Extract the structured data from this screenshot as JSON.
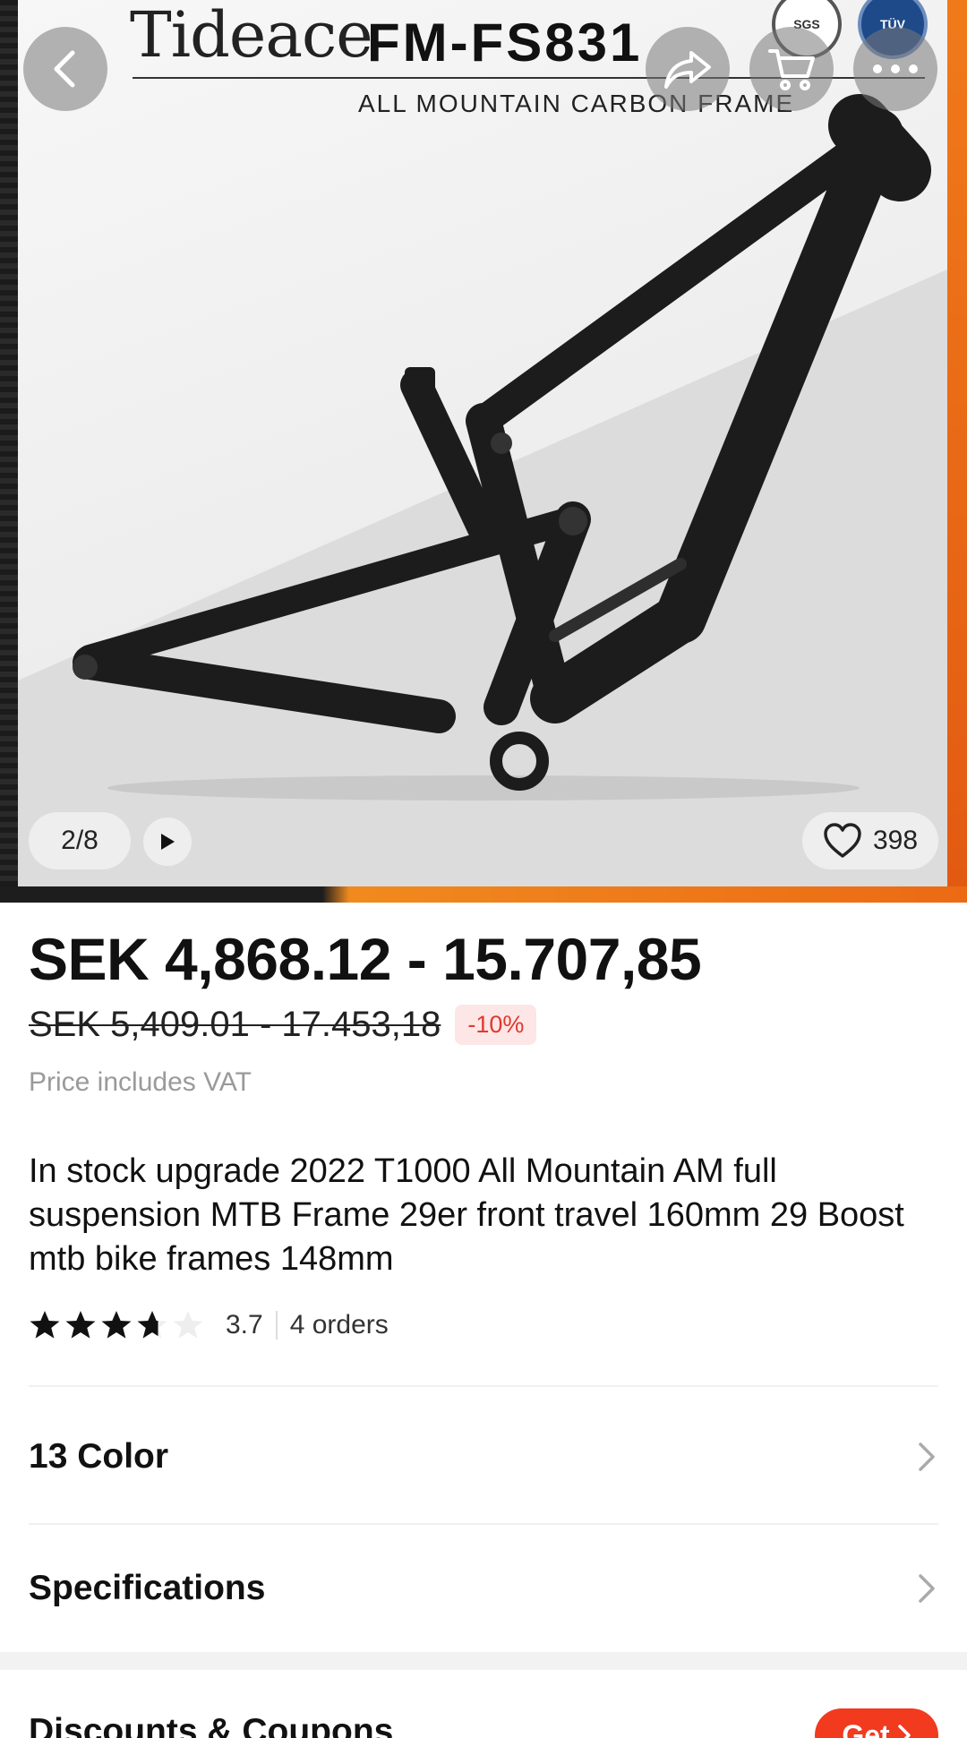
{
  "header": {
    "brand": "Tideace",
    "model": "FM-FS831",
    "subtitle": "ALL MOUNTAIN CARBON FRAME",
    "cert_sgs": "SGS",
    "cert_tuv": "TÜV"
  },
  "gallery": {
    "index": "2/8",
    "likes": "398"
  },
  "price": {
    "current": "SEK 4,868.12 - 15.707,85",
    "original": "SEK 5,409.01 - 17.453,18",
    "discount": "-10%",
    "vat_note": "Price includes VAT"
  },
  "product": {
    "title": "In stock upgrade 2022 T1000 All Mountain AM full suspension MTB Frame 29er front travel 160mm 29 Boost mtb bike frames 148mm",
    "rating": "3.7",
    "rating_fraction": 0.74,
    "orders": "4 orders"
  },
  "options": {
    "color_label": "13 Color",
    "specs_label": "Specifications"
  },
  "discounts": {
    "label": "Discounts & Coupons",
    "get_label": "Get"
  },
  "colors": {
    "accent": "#f23a1f",
    "discount_text": "#e0382f",
    "discount_bg": "#fde6e6",
    "hero_orange": "#ec6a14"
  },
  "icons": [
    "back-arrow-icon",
    "share-icon",
    "cart-icon",
    "more-icon",
    "play-icon",
    "heart-icon",
    "star-icon",
    "chevron-right-icon"
  ]
}
